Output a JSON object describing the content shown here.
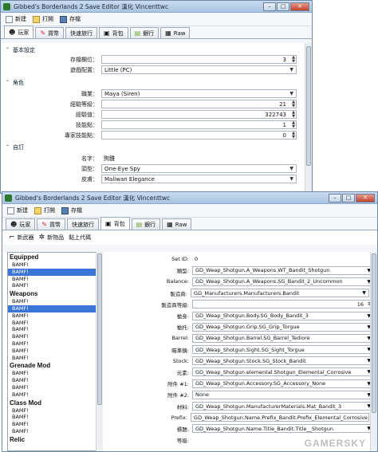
{
  "window1": {
    "title": "Gibbed's Borderlands 2 Save Editor 漢化 Vincenttwc",
    "toolbar": [
      "新建",
      "打開",
      "存檔"
    ],
    "tabs": [
      "玩家",
      "貨幣",
      "快速旅行",
      "背包",
      "銀行",
      "Raw"
    ],
    "sections": {
      "basic": "基本設定",
      "character": "角色",
      "appearance": "自訂"
    },
    "basic": {
      "save_slot_label": "存檔欄位：",
      "save_slot_value": "3",
      "platform_label": "遊戲配置：",
      "platform_value": "Little (PC)"
    },
    "character": {
      "class_label": "職業：",
      "class_value": "Maya (Siren)",
      "level_label": "經驗等級：",
      "level_value": "21",
      "exp_label": "經驗值：",
      "exp_value": "322743",
      "skill_label": "技能點：",
      "skill_value": "1",
      "overpower_label": "專家技能點：",
      "overpower_value": "0"
    },
    "appearance": {
      "name_label": "名字：",
      "name_value": "狗雞",
      "head_label": "頭型：",
      "head_value": "One-Eye Spy",
      "skin_label": "皮膚：",
      "skin_value": "Maliwan Elegance"
    }
  },
  "window2": {
    "title": "Gibbed's Borderlands 2 Save Editor 漢化 Vincenttwc",
    "toolbar": [
      "新建",
      "打開",
      "存檔"
    ],
    "tabs": [
      "玩家",
      "貨幣",
      "快速旅行",
      "背包",
      "銀行",
      "Raw"
    ],
    "subtoolbar": [
      "新武器",
      "新物品",
      "黏上代碼"
    ],
    "tree": [
      {
        "group": "Equipped",
        "items": [
          "BAMF!",
          "BAMF!",
          "BAMF!",
          "BAMF!"
        ],
        "selected": 1
      },
      {
        "group": "Weapons",
        "items": [
          "BAMF!",
          "BAMF!",
          "BAMF!",
          "BAMF!",
          "BAMF!",
          "BAMF!",
          "BAMF!",
          "BAMF!",
          "BAMF!"
        ],
        "selected": 1
      },
      {
        "group": "Grenade Mod",
        "items": [
          "BAMF!",
          "BAMF!",
          "BAMF!",
          "BAMF!"
        ],
        "selected": -1
      },
      {
        "group": "Class Mod",
        "items": [
          "BAMF!",
          "BAMF!",
          "BAMF!",
          "BAMF!"
        ],
        "selected": -1
      },
      {
        "group": "Relic",
        "items": [],
        "selected": -1
      }
    ],
    "props": [
      {
        "label": "Set ID:",
        "value": "0",
        "type": "plain"
      },
      {
        "label": "類型:",
        "value": "GD_Weap_Shotgun.A_Weapons.WT_Bandit_Shotgun",
        "type": "dd"
      },
      {
        "label": "Balance:",
        "value": "GD_Weap_Shotgun.A_Weapons.SG_Bandit_2_Uncommon",
        "type": "dd"
      },
      {
        "label": "製造商:",
        "value": "GD_Manufacturers.Manufacturers.Bandit",
        "type": "dd",
        "warn": true
      },
      {
        "label": "製造商等級:",
        "value": "16",
        "type": "num"
      },
      {
        "label": "槍身:",
        "value": "GD_Weap_Shotgun.Body.SG_Body_Bandit_3",
        "type": "dd"
      },
      {
        "label": "槍托:",
        "value": "GD_Weap_Shotgun.Grip.SG_Grip_Torgue",
        "type": "dd"
      },
      {
        "label": "Barrel:",
        "value": "GD_Weap_Shotgun.Barrel.SG_Barrel_Tediore",
        "type": "dd"
      },
      {
        "label": "瞄準鏡:",
        "value": "GD_Weap_Shotgun.Sight.SG_Sight_Torgue",
        "type": "dd"
      },
      {
        "label": "Stock:",
        "value": "GD_Weap_Shotgun.Stock.SG_Stock_Bandit",
        "type": "dd"
      },
      {
        "label": "元素:",
        "value": "GD_Weap_Shotgun.elemental.Shotgun_Elemental_Corrosive",
        "type": "dd"
      },
      {
        "label": "附件 #1:",
        "value": "GD_Weap_Shotgun.Accessory.SG_Accessory_None",
        "type": "dd"
      },
      {
        "label": "附件 #2:",
        "value": "None",
        "type": "dd"
      },
      {
        "label": "材料:",
        "value": "GD_Weap_Shotgun.ManufacturerMaterials.Mat_Bandit_3",
        "type": "dd"
      },
      {
        "label": "Prefix:",
        "value": "GD_Weap_Shotgun.Name.Prefix_Bandit.Prefix_Elemental_Corrosive",
        "type": "dd",
        "warn": true
      },
      {
        "label": "標題:",
        "value": "GD_Weap_Shotgun.Name.Title_Bandit.Title__Shotgun",
        "type": "dd"
      },
      {
        "label": "等級:",
        "value": "",
        "type": "plain"
      }
    ]
  },
  "watermark": "GAMERSKY"
}
